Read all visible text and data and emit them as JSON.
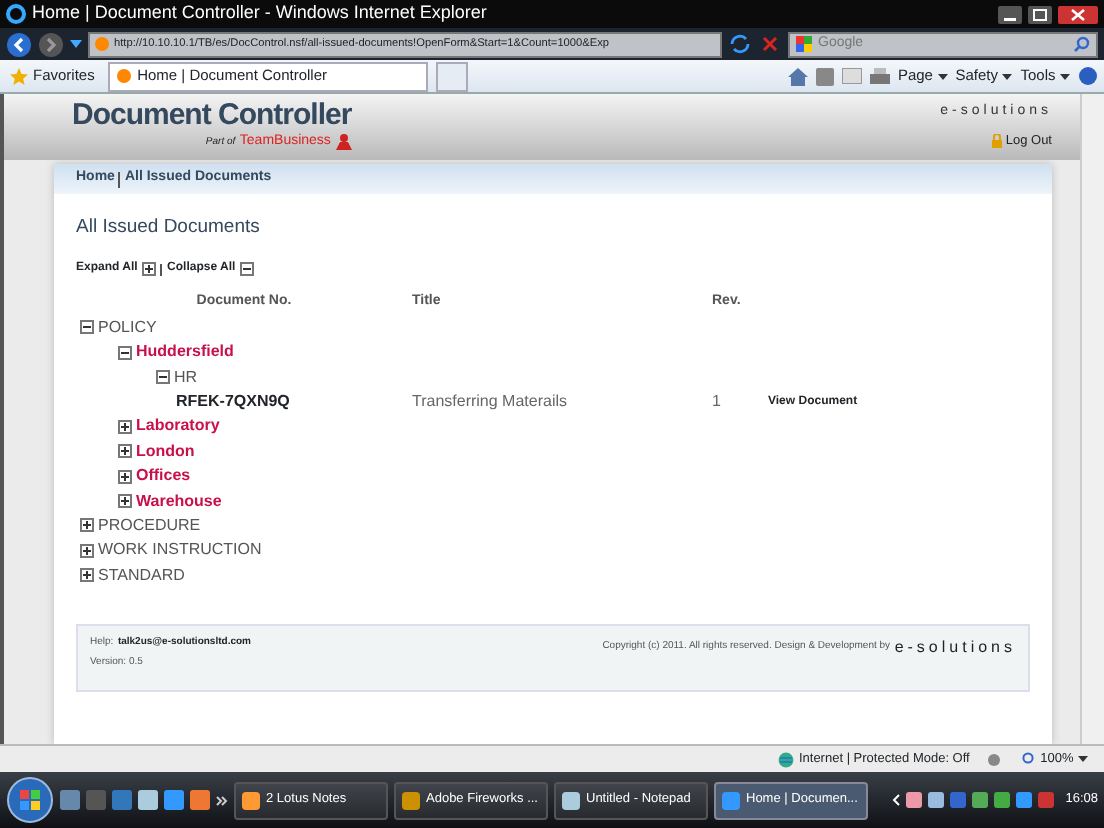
{
  "window": {
    "title": "Home | Document Controller - Windows Internet Explorer"
  },
  "address_bar": {
    "url": "http://10.10.10.1/TB/es/DocControl.nsf/all-issued-documents!OpenForm&Start=1&Count=1000&Exp"
  },
  "search": {
    "placeholder": "Google"
  },
  "favorites": "Favorites",
  "tabs": [
    {
      "label": "Home | Document Controller",
      "selected": true
    }
  ],
  "command_bar": [
    "Page",
    "Safety",
    "Tools"
  ],
  "header": {
    "logo": "Document Controller",
    "part_of": "Part of",
    "brand": "TeamBusiness",
    "company": "e-solutions",
    "logout": "Log Out"
  },
  "breadcrumb": [
    "Home",
    "All Issued Documents"
  ],
  "page_title": "All Issued Documents",
  "expand_all": "Expand All",
  "collapse_all": "Collapse All",
  "columns": [
    "Document No.",
    "Title",
    "Rev."
  ],
  "tree": [
    {
      "label": "POLICY",
      "expanded": true,
      "children": [
        {
          "label": "Huddersfield",
          "expanded": true,
          "children": [
            {
              "label": "HR",
              "expanded": true,
              "documents": [
                {
                  "doc_no": "RFEK-7QXN9Q",
                  "title": "Transferring Materails",
                  "rev": "1",
                  "action": "View Document"
                }
              ]
            }
          ]
        },
        {
          "label": "Laboratory",
          "expanded": false
        },
        {
          "label": "London",
          "expanded": false
        },
        {
          "label": "Offices",
          "expanded": false
        },
        {
          "label": "Warehouse",
          "expanded": false
        }
      ]
    },
    {
      "label": "PROCEDURE",
      "expanded": false
    },
    {
      "label": "WORK INSTRUCTION",
      "expanded": false
    },
    {
      "label": "STANDARD",
      "expanded": false
    }
  ],
  "footer": {
    "help_label": "Help:",
    "email": "talk2us@e-solutionsltd.com",
    "version": "Version: 0.5",
    "copyright": "Copyright (c) 2011. All rights reserved. Design & Development by",
    "logo": "e-solutions"
  },
  "status_bar": {
    "zone": "Internet | Protected Mode: Off",
    "zoom": "100%"
  },
  "taskbar": {
    "buttons": [
      {
        "label": "2 Lotus Notes",
        "selected": false
      },
      {
        "label": "Adobe Fireworks ...",
        "selected": false
      },
      {
        "label": "Untitled - Notepad",
        "selected": false
      },
      {
        "label": "Home | Documen...",
        "selected": true
      }
    ],
    "clock": "16:08"
  }
}
